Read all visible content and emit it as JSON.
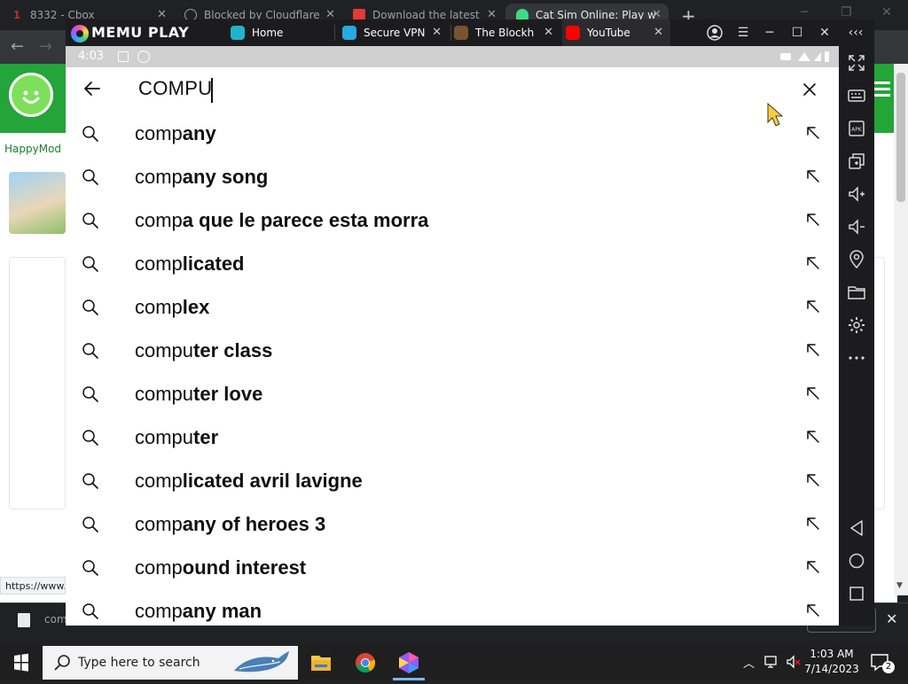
{
  "chrome": {
    "tabs": [
      {
        "label": "8332 - Cbox",
        "icon": "cbox-favicon",
        "icon_color": "#c62828"
      },
      {
        "label": "Blocked by Cloudflare",
        "icon": "globe-icon",
        "icon_color": "#9aa0a6"
      },
      {
        "label": "Download the latest",
        "icon": "store-favicon",
        "icon_color": "#e53935"
      },
      {
        "label": "Cat Sim Online: Play w",
        "icon": "android-favicon",
        "icon_color": "#3ddc84"
      }
    ],
    "new_tab_label": "+",
    "status_url": "https://www."
  },
  "site": {
    "breadcrumb": "HappyMod :",
    "brand_color": "#23a53a"
  },
  "download_bar": {
    "file_name": "com"
  },
  "memu": {
    "brand": "MEMU PLAY",
    "tabs": [
      {
        "label": "Home",
        "icon": "home-app-icon",
        "icon_color": "#1fb5c9"
      },
      {
        "label": "Secure VPN",
        "icon": "vpn-app-icon",
        "icon_color": "#27a9e1"
      },
      {
        "label": "The Blockh",
        "icon": "blockhead-app-icon",
        "icon_color": "#7a5230"
      },
      {
        "label": "YouTube",
        "icon": "youtube-app-icon",
        "icon_color": "#ff0000"
      }
    ],
    "status_time": "4:03"
  },
  "search": {
    "query": "COMPU",
    "suggestions": [
      {
        "typed": "comp",
        "rest": "any"
      },
      {
        "typed": "comp",
        "rest": "any song"
      },
      {
        "typed": "comp",
        "rest": "a que le parece esta morra"
      },
      {
        "typed": "comp",
        "rest": "licated"
      },
      {
        "typed": "comp",
        "rest": "lex"
      },
      {
        "typed": "compu",
        "rest": "ter class"
      },
      {
        "typed": "compu",
        "rest": "ter love"
      },
      {
        "typed": "compu",
        "rest": "ter"
      },
      {
        "typed": "comp",
        "rest": "licated avril lavigne"
      },
      {
        "typed": "comp",
        "rest": "any of heroes 3"
      },
      {
        "typed": "comp",
        "rest": "ound interest"
      },
      {
        "typed": "comp",
        "rest": "any man"
      }
    ]
  },
  "taskbar": {
    "search_placeholder": "Type here to search",
    "time": "1:03 AM",
    "date": "7/14/2023",
    "notification_count": "2"
  }
}
